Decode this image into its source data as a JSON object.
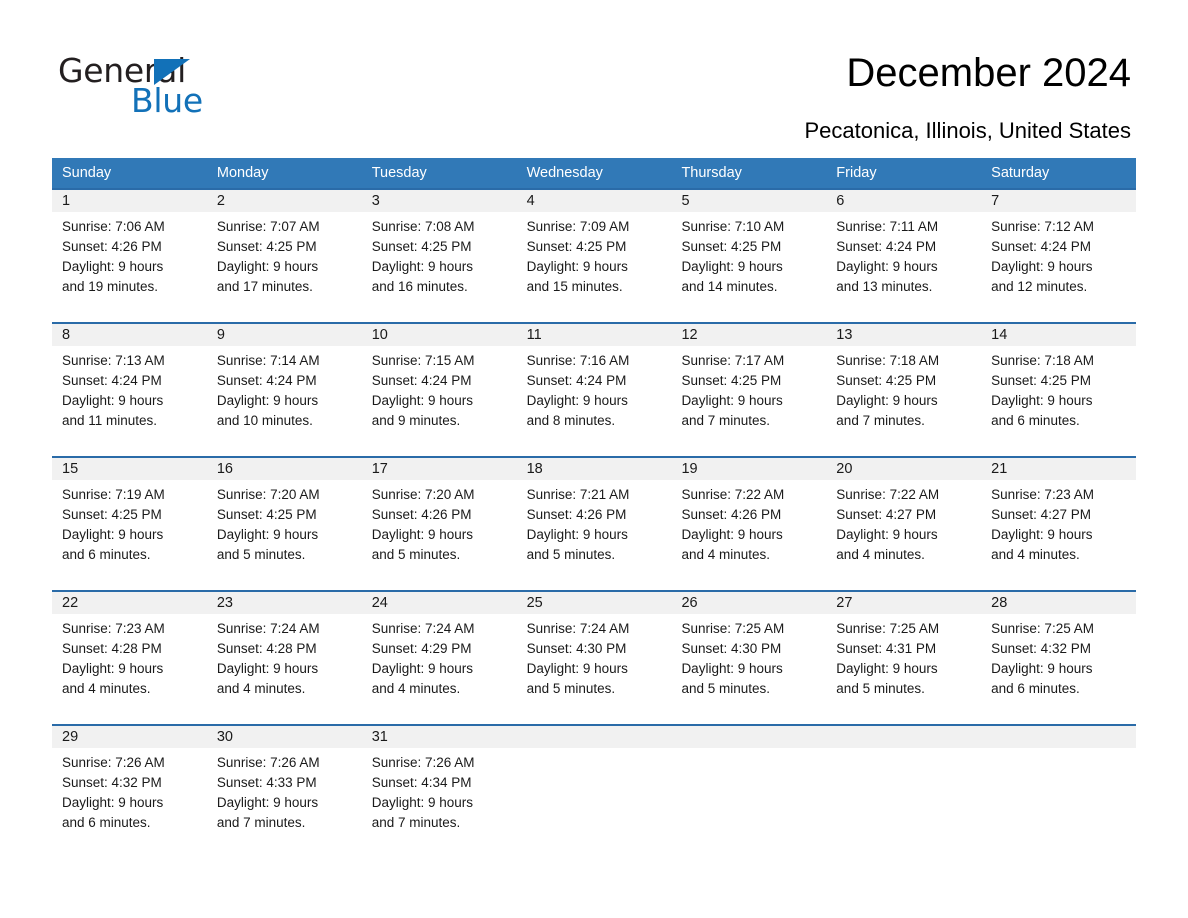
{
  "brand": {
    "name_part1": "General",
    "name_part2": "Blue",
    "color_dark": "#231f20",
    "color_blue": "#1271b8"
  },
  "header": {
    "month_title": "December 2024",
    "location": "Pecatonica, Illinois, United States"
  },
  "theme": {
    "header_bar": "#3179b7",
    "row_rule": "#2a6ba8",
    "day_band": "#f1f1f1",
    "text": "#1a1a1a"
  },
  "labels": {
    "sunrise_prefix": "Sunrise:",
    "sunset_prefix": "Sunset:",
    "daylight_prefix": "Daylight:"
  },
  "weekdays": [
    "Sunday",
    "Monday",
    "Tuesday",
    "Wednesday",
    "Thursday",
    "Friday",
    "Saturday"
  ],
  "weeks": [
    [
      {
        "day": "1",
        "sunrise": "Sunrise: 7:06 AM",
        "sunset": "Sunset: 4:26 PM",
        "daylight_1": "Daylight: 9 hours",
        "daylight_2": "and 19 minutes."
      },
      {
        "day": "2",
        "sunrise": "Sunrise: 7:07 AM",
        "sunset": "Sunset: 4:25 PM",
        "daylight_1": "Daylight: 9 hours",
        "daylight_2": "and 17 minutes."
      },
      {
        "day": "3",
        "sunrise": "Sunrise: 7:08 AM",
        "sunset": "Sunset: 4:25 PM",
        "daylight_1": "Daylight: 9 hours",
        "daylight_2": "and 16 minutes."
      },
      {
        "day": "4",
        "sunrise": "Sunrise: 7:09 AM",
        "sunset": "Sunset: 4:25 PM",
        "daylight_1": "Daylight: 9 hours",
        "daylight_2": "and 15 minutes."
      },
      {
        "day": "5",
        "sunrise": "Sunrise: 7:10 AM",
        "sunset": "Sunset: 4:25 PM",
        "daylight_1": "Daylight: 9 hours",
        "daylight_2": "and 14 minutes."
      },
      {
        "day": "6",
        "sunrise": "Sunrise: 7:11 AM",
        "sunset": "Sunset: 4:24 PM",
        "daylight_1": "Daylight: 9 hours",
        "daylight_2": "and 13 minutes."
      },
      {
        "day": "7",
        "sunrise": "Sunrise: 7:12 AM",
        "sunset": "Sunset: 4:24 PM",
        "daylight_1": "Daylight: 9 hours",
        "daylight_2": "and 12 minutes."
      }
    ],
    [
      {
        "day": "8",
        "sunrise": "Sunrise: 7:13 AM",
        "sunset": "Sunset: 4:24 PM",
        "daylight_1": "Daylight: 9 hours",
        "daylight_2": "and 11 minutes."
      },
      {
        "day": "9",
        "sunrise": "Sunrise: 7:14 AM",
        "sunset": "Sunset: 4:24 PM",
        "daylight_1": "Daylight: 9 hours",
        "daylight_2": "and 10 minutes."
      },
      {
        "day": "10",
        "sunrise": "Sunrise: 7:15 AM",
        "sunset": "Sunset: 4:24 PM",
        "daylight_1": "Daylight: 9 hours",
        "daylight_2": "and 9 minutes."
      },
      {
        "day": "11",
        "sunrise": "Sunrise: 7:16 AM",
        "sunset": "Sunset: 4:24 PM",
        "daylight_1": "Daylight: 9 hours",
        "daylight_2": "and 8 minutes."
      },
      {
        "day": "12",
        "sunrise": "Sunrise: 7:17 AM",
        "sunset": "Sunset: 4:25 PM",
        "daylight_1": "Daylight: 9 hours",
        "daylight_2": "and 7 minutes."
      },
      {
        "day": "13",
        "sunrise": "Sunrise: 7:18 AM",
        "sunset": "Sunset: 4:25 PM",
        "daylight_1": "Daylight: 9 hours",
        "daylight_2": "and 7 minutes."
      },
      {
        "day": "14",
        "sunrise": "Sunrise: 7:18 AM",
        "sunset": "Sunset: 4:25 PM",
        "daylight_1": "Daylight: 9 hours",
        "daylight_2": "and 6 minutes."
      }
    ],
    [
      {
        "day": "15",
        "sunrise": "Sunrise: 7:19 AM",
        "sunset": "Sunset: 4:25 PM",
        "daylight_1": "Daylight: 9 hours",
        "daylight_2": "and 6 minutes."
      },
      {
        "day": "16",
        "sunrise": "Sunrise: 7:20 AM",
        "sunset": "Sunset: 4:25 PM",
        "daylight_1": "Daylight: 9 hours",
        "daylight_2": "and 5 minutes."
      },
      {
        "day": "17",
        "sunrise": "Sunrise: 7:20 AM",
        "sunset": "Sunset: 4:26 PM",
        "daylight_1": "Daylight: 9 hours",
        "daylight_2": "and 5 minutes."
      },
      {
        "day": "18",
        "sunrise": "Sunrise: 7:21 AM",
        "sunset": "Sunset: 4:26 PM",
        "daylight_1": "Daylight: 9 hours",
        "daylight_2": "and 5 minutes."
      },
      {
        "day": "19",
        "sunrise": "Sunrise: 7:22 AM",
        "sunset": "Sunset: 4:26 PM",
        "daylight_1": "Daylight: 9 hours",
        "daylight_2": "and 4 minutes."
      },
      {
        "day": "20",
        "sunrise": "Sunrise: 7:22 AM",
        "sunset": "Sunset: 4:27 PM",
        "daylight_1": "Daylight: 9 hours",
        "daylight_2": "and 4 minutes."
      },
      {
        "day": "21",
        "sunrise": "Sunrise: 7:23 AM",
        "sunset": "Sunset: 4:27 PM",
        "daylight_1": "Daylight: 9 hours",
        "daylight_2": "and 4 minutes."
      }
    ],
    [
      {
        "day": "22",
        "sunrise": "Sunrise: 7:23 AM",
        "sunset": "Sunset: 4:28 PM",
        "daylight_1": "Daylight: 9 hours",
        "daylight_2": "and 4 minutes."
      },
      {
        "day": "23",
        "sunrise": "Sunrise: 7:24 AM",
        "sunset": "Sunset: 4:28 PM",
        "daylight_1": "Daylight: 9 hours",
        "daylight_2": "and 4 minutes."
      },
      {
        "day": "24",
        "sunrise": "Sunrise: 7:24 AM",
        "sunset": "Sunset: 4:29 PM",
        "daylight_1": "Daylight: 9 hours",
        "daylight_2": "and 4 minutes."
      },
      {
        "day": "25",
        "sunrise": "Sunrise: 7:24 AM",
        "sunset": "Sunset: 4:30 PM",
        "daylight_1": "Daylight: 9 hours",
        "daylight_2": "and 5 minutes."
      },
      {
        "day": "26",
        "sunrise": "Sunrise: 7:25 AM",
        "sunset": "Sunset: 4:30 PM",
        "daylight_1": "Daylight: 9 hours",
        "daylight_2": "and 5 minutes."
      },
      {
        "day": "27",
        "sunrise": "Sunrise: 7:25 AM",
        "sunset": "Sunset: 4:31 PM",
        "daylight_1": "Daylight: 9 hours",
        "daylight_2": "and 5 minutes."
      },
      {
        "day": "28",
        "sunrise": "Sunrise: 7:25 AM",
        "sunset": "Sunset: 4:32 PM",
        "daylight_1": "Daylight: 9 hours",
        "daylight_2": "and 6 minutes."
      }
    ],
    [
      {
        "day": "29",
        "sunrise": "Sunrise: 7:26 AM",
        "sunset": "Sunset: 4:32 PM",
        "daylight_1": "Daylight: 9 hours",
        "daylight_2": "and 6 minutes."
      },
      {
        "day": "30",
        "sunrise": "Sunrise: 7:26 AM",
        "sunset": "Sunset: 4:33 PM",
        "daylight_1": "Daylight: 9 hours",
        "daylight_2": "and 7 minutes."
      },
      {
        "day": "31",
        "sunrise": "Sunrise: 7:26 AM",
        "sunset": "Sunset: 4:34 PM",
        "daylight_1": "Daylight: 9 hours",
        "daylight_2": "and 7 minutes."
      },
      {
        "day": "",
        "sunrise": "",
        "sunset": "",
        "daylight_1": "",
        "daylight_2": ""
      },
      {
        "day": "",
        "sunrise": "",
        "sunset": "",
        "daylight_1": "",
        "daylight_2": ""
      },
      {
        "day": "",
        "sunrise": "",
        "sunset": "",
        "daylight_1": "",
        "daylight_2": ""
      },
      {
        "day": "",
        "sunrise": "",
        "sunset": "",
        "daylight_1": "",
        "daylight_2": ""
      }
    ]
  ]
}
